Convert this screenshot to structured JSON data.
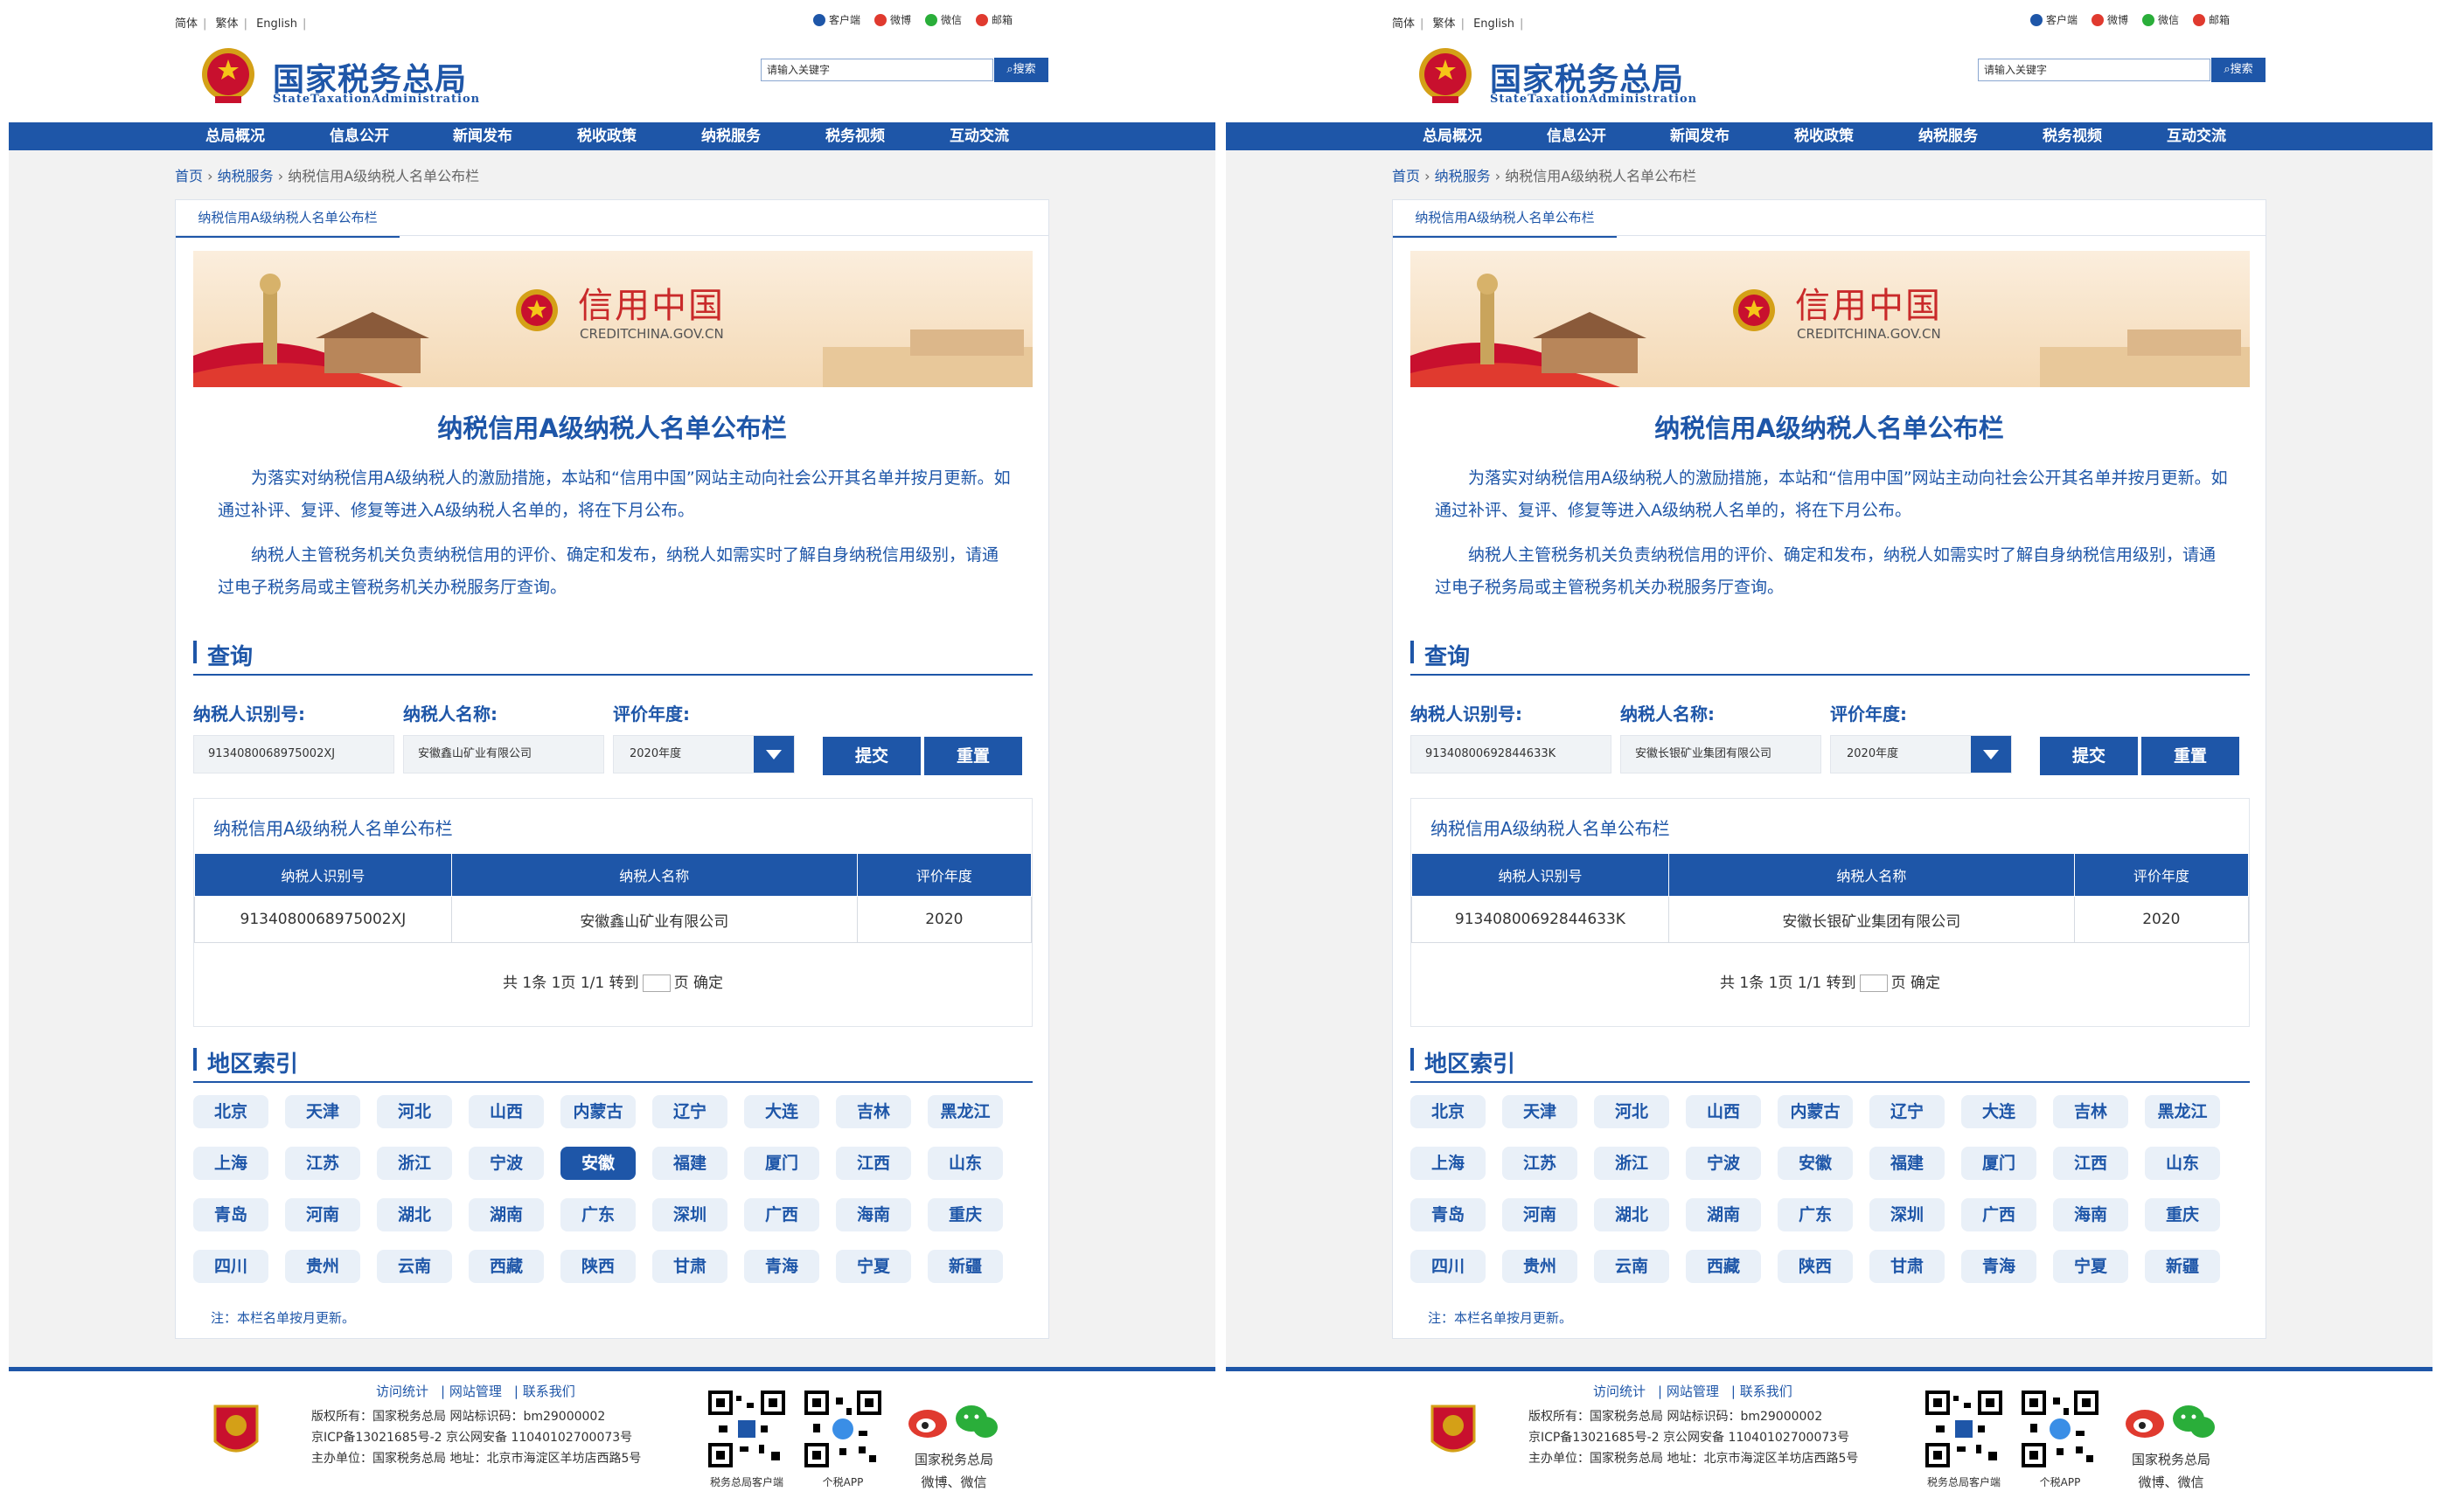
{
  "top": {
    "langs": [
      "简体",
      "繁体",
      "English"
    ],
    "links": [
      {
        "label": "客户端",
        "icon": "client-icon",
        "color": "#1e56a8"
      },
      {
        "label": "微博",
        "icon": "weibo-icon",
        "color": "#e03a2f"
      },
      {
        "label": "微信",
        "icon": "wechat-icon",
        "color": "#2aae3a"
      },
      {
        "label": "邮箱",
        "icon": "mail-icon",
        "color": "#e03a2f"
      }
    ]
  },
  "header": {
    "title": "国家税务总局",
    "subtitle": "StateTaxationAdministration",
    "search_placeholder": "请输入关键字",
    "search_button": "搜索"
  },
  "nav": [
    "总局概况",
    "信息公开",
    "新闻发布",
    "税收政策",
    "纳税服务",
    "税务视频",
    "互动交流"
  ],
  "breadcrumb": [
    "首页",
    "纳税服务",
    "纳税信用A级纳税人名单公布栏"
  ],
  "tab": "纳税信用A级纳税人名单公布栏",
  "banner": {
    "title": "信用中国",
    "sub": "CREDITCHINA.GOV.CN"
  },
  "page_title": "纳税信用A级纳税人名单公布栏",
  "paragraphs": [
    "为落实对纳税信用A级纳税人的激励措施，本站和“信用中国”网站主动向社会公开其名单并按月更新。如通过补评、复评、修复等进入A级纳税人名单的，将在下月公布。",
    "纳税人主管税务机关负责纳税信用的评价、确定和发布，纳税人如需实时了解自身纳税信用级别，请通过电子税务局或主管税务机关办税服务厅查询。"
  ],
  "query": {
    "section": "查询",
    "label_id": "纳税人识别号:",
    "label_name": "纳税人名称:",
    "label_year": "评价年度:",
    "submit": "提交",
    "reset": "重置"
  },
  "result": {
    "title": "纳税信用A级纳税人名单公布栏",
    "headers": [
      "纳税人识别号",
      "纳税人名称",
      "评价年度"
    ],
    "pager": "共 1条 1页 1/1 转到",
    "pager_suffix": "页 确定"
  },
  "regions_title": "地区索引",
  "regions": [
    "北京",
    "天津",
    "河北",
    "山西",
    "内蒙古",
    "辽宁",
    "大连",
    "吉林",
    "黑龙江",
    "上海",
    "江苏",
    "浙江",
    "宁波",
    "安徽",
    "福建",
    "厦门",
    "江西",
    "山东",
    "青岛",
    "河南",
    "湖北",
    "湖南",
    "广东",
    "深圳",
    "广西",
    "海南",
    "重庆",
    "四川",
    "贵州",
    "云南",
    "西藏",
    "陕西",
    "甘肃",
    "青海",
    "宁夏",
    "新疆"
  ],
  "note": "注：本栏名单按月更新。",
  "footer": {
    "links": [
      "访问统计",
      "网站管理",
      "联系我们"
    ],
    "info": [
      "版权所有：国家税务总局    网站标识码：bm29000002",
      "京ICP备13021685号-2    京公网安备 11040102700073号",
      "主办单位：国家税务总局    地址：北京市海淀区羊坊店西路5号"
    ],
    "qr1": "税务总局客户端",
    "qr2": "个税APP",
    "social_label": "国家税务总局",
    "social_sub": "微博、微信"
  },
  "left": {
    "id_value": "9134080068975002XJ",
    "name_value": "安徽鑫山矿业有限公司",
    "year_value": "2020年度",
    "row": [
      "9134080068975002XJ",
      "安徽鑫山矿业有限公司",
      "2020"
    ],
    "active_region": "安徽"
  },
  "right": {
    "id_value": "91340800692844633K",
    "name_value": "安徽长银矿业集团有限公司",
    "year_value": "2020年度",
    "row": [
      "91340800692844633K",
      "安徽长银矿业集团有限公司",
      "2020"
    ],
    "active_region": ""
  },
  "colors": {
    "brand": "#1e56a8",
    "red": "#c92a2a"
  }
}
